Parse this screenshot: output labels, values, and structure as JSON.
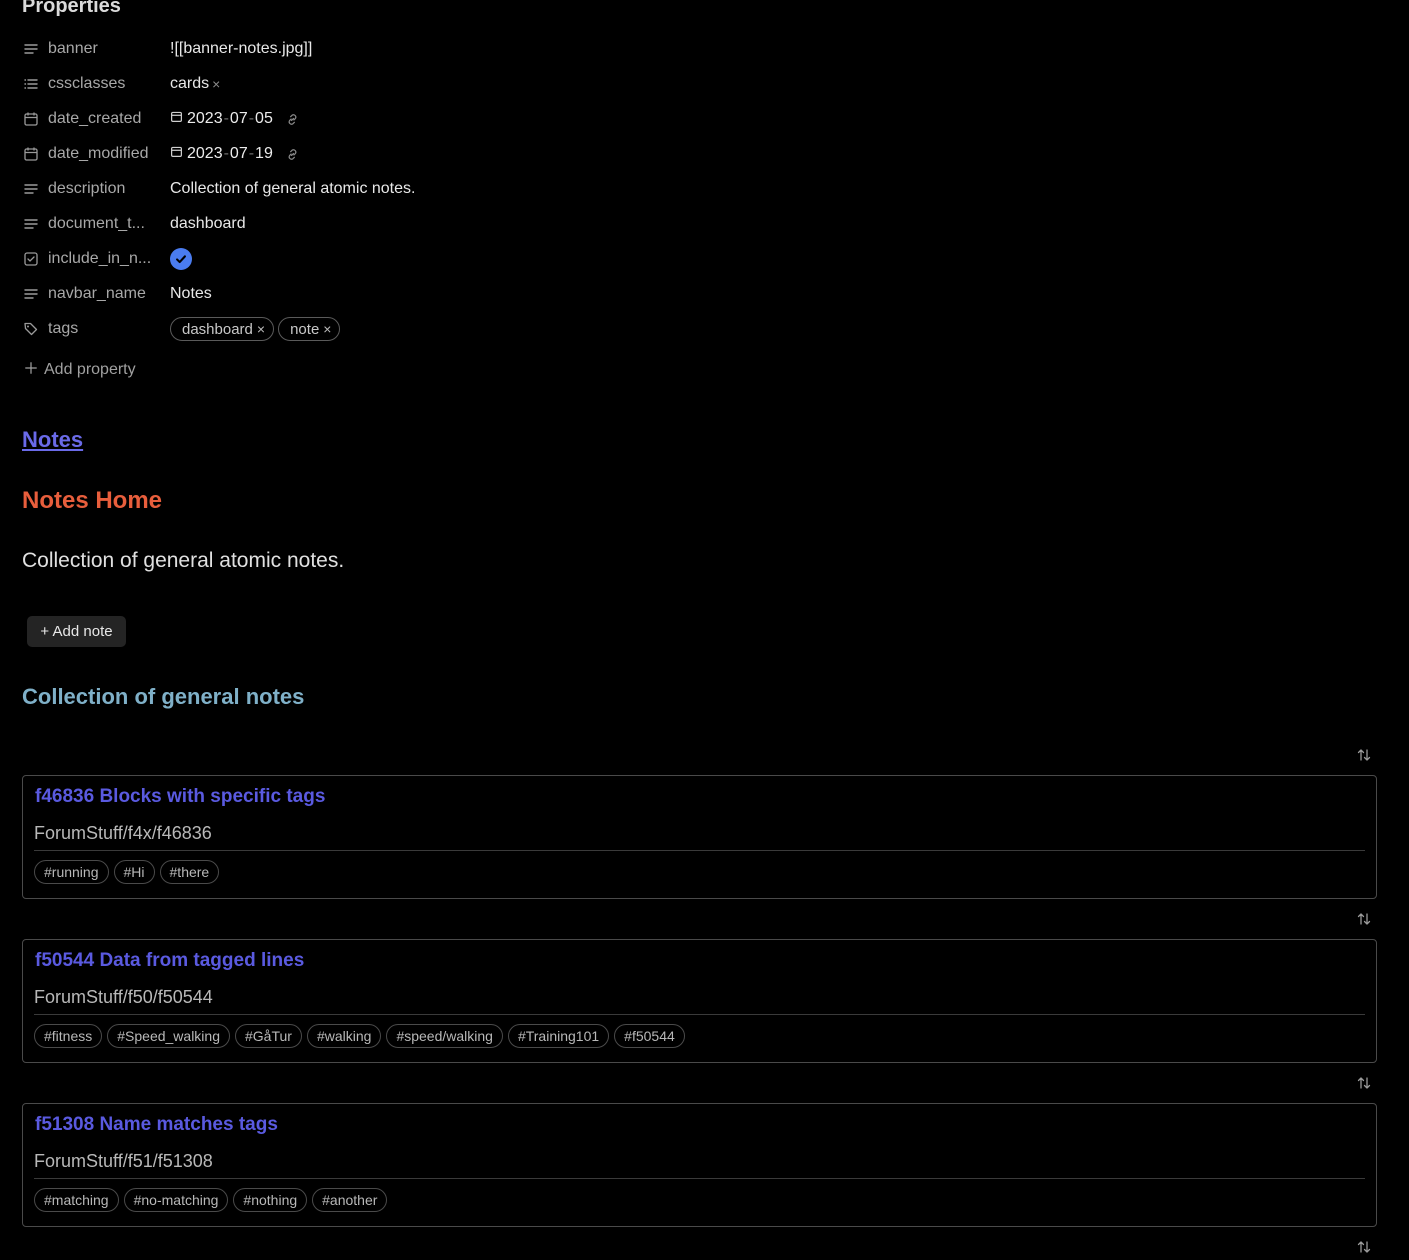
{
  "properties": {
    "title": "Properties",
    "rows": [
      {
        "icon": "text-lines-icon",
        "key": "banner",
        "value": "![[banner-notes.jpg]]"
      },
      {
        "icon": "list-icon",
        "key": "cssclasses",
        "value": "cards"
      },
      {
        "icon": "calendar-icon",
        "key": "date_created",
        "date": {
          "y": "2023",
          "m": "07",
          "d": "05"
        }
      },
      {
        "icon": "calendar-icon",
        "key": "date_modified",
        "date": {
          "y": "2023",
          "m": "07",
          "d": "19"
        }
      },
      {
        "icon": "text-lines-icon",
        "key": "description",
        "value": "Collection of general atomic notes."
      },
      {
        "icon": "text-lines-icon",
        "key": "document_t...",
        "value": "dashboard"
      },
      {
        "icon": "checkbox-icon",
        "key": "include_in_n...",
        "checked": true
      },
      {
        "icon": "text-lines-icon",
        "key": "navbar_name",
        "value": "Notes"
      },
      {
        "icon": "tags-icon",
        "key": "tags",
        "tags": [
          "dashboard",
          "note"
        ]
      }
    ],
    "add_label": "Add property",
    "remove_mark": "×",
    "date_separator": "-"
  },
  "body": {
    "notes_link": "Notes",
    "heading": "Notes Home",
    "description": "Collection of general atomic notes.",
    "add_note_label": "+ Add note",
    "collection_heading": "Collection of general notes"
  },
  "cards": [
    {
      "title": "f46836 Blocks with specific tags",
      "path": "ForumStuff/f4x/f46836",
      "tags": [
        "#running",
        "#Hi",
        "#there"
      ]
    },
    {
      "title": "f50544 Data from tagged lines",
      "path": "ForumStuff/f50/f50544",
      "tags": [
        "#fitness",
        "#Speed_walking",
        "#GåTur",
        "#walking",
        "#speed/walking",
        "#Training101",
        "#f50544"
      ]
    },
    {
      "title": "f51308 Name matches tags",
      "path": "ForumStuff/f51/f51308",
      "tags": [
        "#matching",
        "#no-matching",
        "#nothing",
        "#another"
      ]
    }
  ],
  "colors": {
    "accent_link": "#6a6ae8",
    "heading_orange": "#e85e3c",
    "heading_teal": "#7fb0c8",
    "checkbox_blue": "#4a7cf0"
  }
}
